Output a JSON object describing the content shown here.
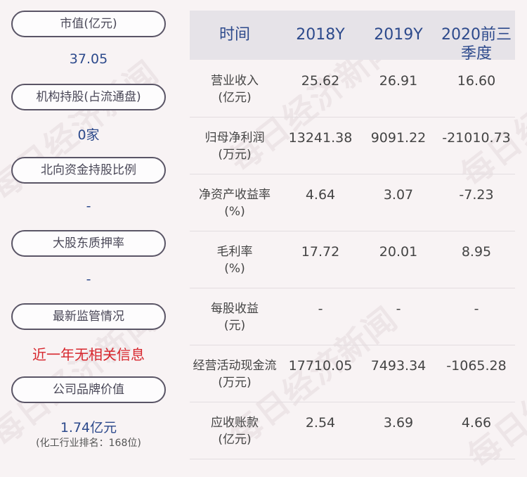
{
  "left_panel": {
    "items": [
      {
        "label": "市值(亿元)",
        "value": "37.05"
      },
      {
        "label": "机构持股(占流通盘)",
        "value": "0家"
      },
      {
        "label": "北向资金持股比例",
        "value": "-"
      },
      {
        "label": "大股东质押率",
        "value": "-"
      },
      {
        "label": "最新监管情况",
        "value": "近一年无相关信息"
      },
      {
        "label": "公司品牌价值",
        "value": "1.74亿元",
        "note": "(化工行业排名：168位)"
      }
    ]
  },
  "table": {
    "headers": [
      "时间",
      "2018Y",
      "2019Y",
      "2020前三",
      "季度"
    ],
    "rows": [
      {
        "label1": "营业收入",
        "label2": "(亿元)",
        "values": [
          "25.62",
          "26.91",
          "16.60"
        ]
      },
      {
        "label1": "归母净利润",
        "label2": "(万元)",
        "values": [
          "13241.38",
          "9091.22",
          "-21010.73"
        ]
      },
      {
        "label1": "净资产收益率",
        "label2": "(%)",
        "values": [
          "4.64",
          "3.07",
          "-7.23"
        ]
      },
      {
        "label1": "毛利率",
        "label2": "(%)",
        "values": [
          "17.72",
          "20.01",
          "8.95"
        ]
      },
      {
        "label1": "每股收益",
        "label2": "(元)",
        "values": [
          "-",
          "-",
          "-"
        ]
      },
      {
        "label1": "经营活动现金流",
        "label2": "(万元)",
        "values": [
          "17710.05",
          "7493.34",
          "-1065.28"
        ]
      },
      {
        "label1": "应收账款",
        "label2": "(亿元)",
        "values": [
          "2.54",
          "3.69",
          "4.66"
        ]
      }
    ]
  },
  "watermark": "每日经济新闻",
  "colors": {
    "accent_blue": "#2d4a8c",
    "alert_red": "#d7262d",
    "header_bg": "#e6e3e8",
    "page_bg": "#f8f3f4"
  }
}
